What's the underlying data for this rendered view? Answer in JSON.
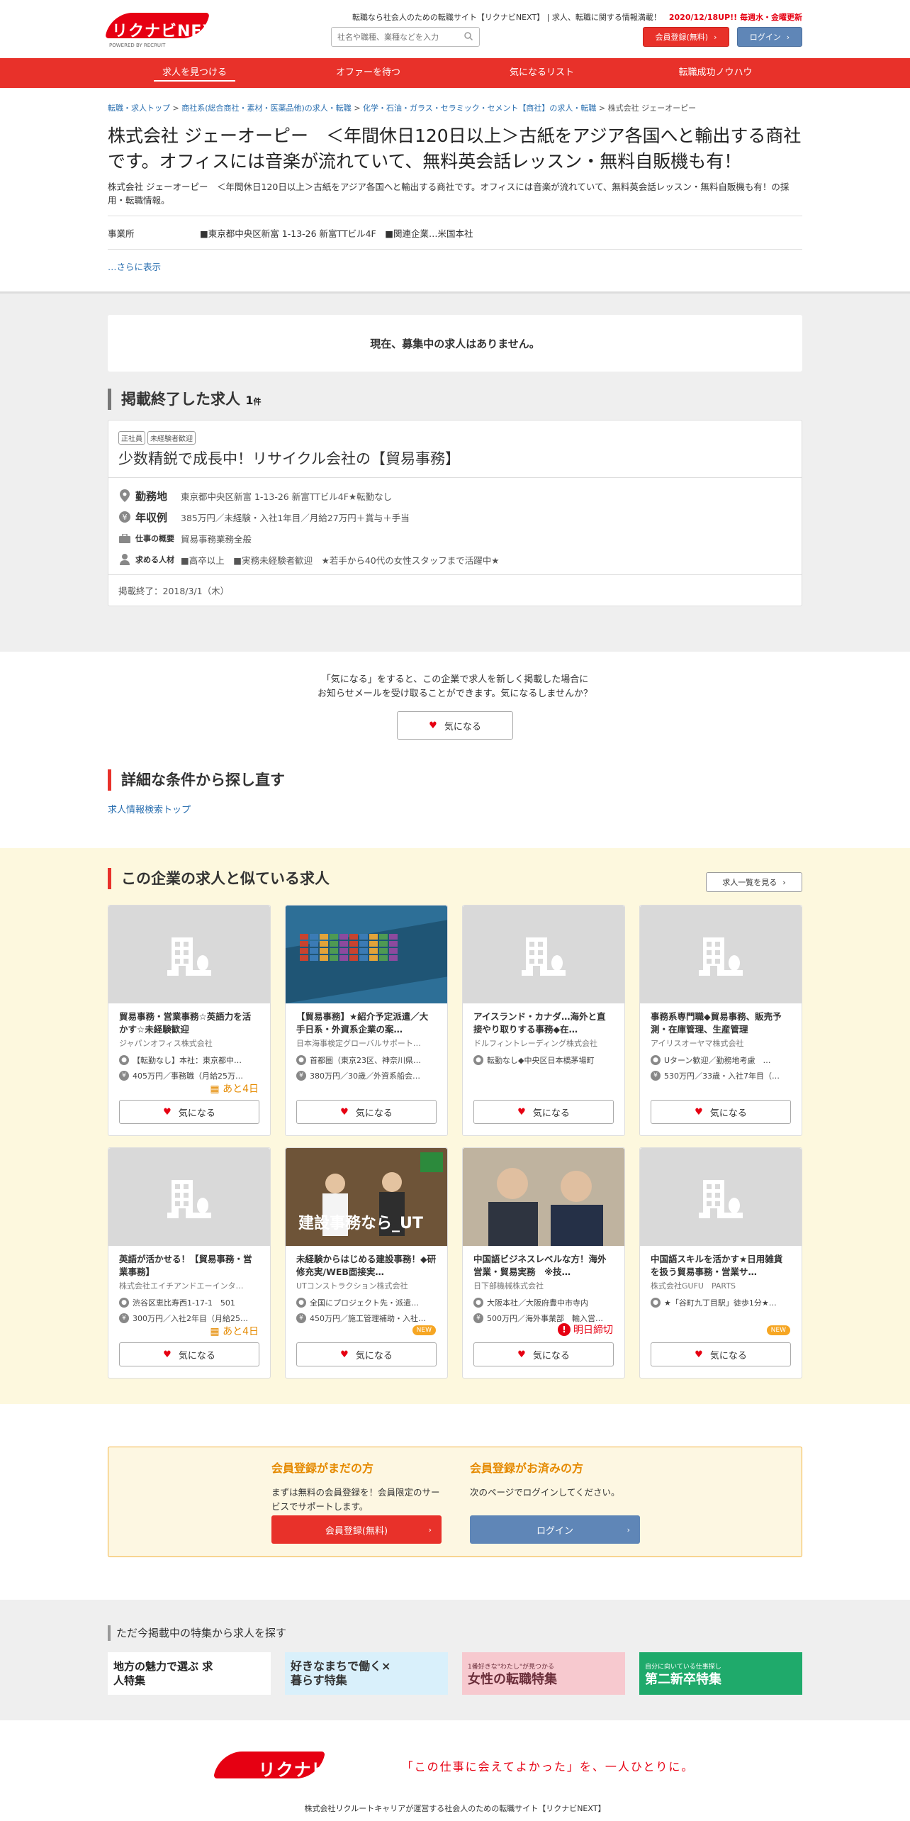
{
  "header": {
    "logo_text": "リクナビNEXT",
    "logo_sub": "POWERED BY RECRUIT",
    "tagline": "転職なら社会人のための転職サイト【リクナビNEXT】 | 求人、転職に関する情報満載！",
    "update": "2020/12/18UP!! 毎週水・金曜更新",
    "search_placeholder": "社名や職種、業種などを入力",
    "register_label": "会員登録(無料)",
    "login_label": "ログイン"
  },
  "nav": {
    "items": [
      {
        "label": "求人を見つける"
      },
      {
        "label": "オファーを待つ"
      },
      {
        "label": "気になるリスト"
      },
      {
        "label": "転職成功ノウハウ"
      }
    ]
  },
  "breadcrumb": {
    "items": [
      "転職・求人トップ",
      "商社系(総合商社・素材・医薬品他)の求人・転職",
      "化学・石油・ガラス・セラミック・セメント【商社】の求人・転職"
    ],
    "sep": ">",
    "current": "株式会社 ジェーオーピー"
  },
  "company": {
    "title": "株式会社 ジェーオーピー　＜年間休日120日以上＞古紙をアジア各国へと輸出する商社です。オフィスには音楽が流れていて、無料英会話レッスン・無料自販機も有！",
    "description": "株式会社 ジェーオーピー　＜年間休日120日以上＞古紙をアジア各国へと輸出する商社です。オフィスには音楽が流れていて、無料英会話レッスン・無料自販機も有！の採用・転職情報。",
    "office_label": "事業所",
    "office_value": "■東京都中央区新富 1-13-26 新富TTビル4F　■関連企業…米国本社",
    "more_label": "…さらに表示"
  },
  "status": {
    "no_jobs": "現在、募集中の求人はありません。"
  },
  "ended": {
    "heading": "掲載終了した求人",
    "count": "1",
    "count_unit": "件",
    "tags": [
      "正社員",
      "未経験者歓迎"
    ],
    "job_title": "少数精鋭で成長中！リサイクル会社の【貿易事務】",
    "rows": [
      {
        "label": "勤務地",
        "value": "東京都中央区新富 1-13-26 新富TTビル4F★転勤なし"
      },
      {
        "label": "年収例",
        "value": "385万円／未経験・入社1年目／月給27万円＋賞与＋手当"
      },
      {
        "label": "仕事の概要",
        "value": "貿易事務業務全般"
      },
      {
        "label": "求める人材",
        "value": "■高卒以上　■実務未経験者歓迎　★若手から40代の女性スタッフまで活躍中★"
      }
    ],
    "end_date": "掲載終了：2018/3/1（木）"
  },
  "favorite_prompt": {
    "line1": "「気になる」をすると、この企業で求人を新しく掲載した場合に",
    "line2": "お知らせメールを受け取ることができます。気になるしませんか？",
    "button": "気になる"
  },
  "detail_search": {
    "heading": "詳細な条件から探し直す",
    "link": "求人情報検索トップ"
  },
  "similar": {
    "heading": "この企業の求人と似ている求人",
    "list_button": "求人一覧を見る",
    "fav_label": "気になる",
    "cards": [
      {
        "title": "貿易事務・営業事務☆英語力を活かす☆未経験歓迎",
        "company": "ジャパンオフィス株式会社",
        "loc": "【転勤なし】本社：東京都中…",
        "sal": "405万円／事務職（月給25万…",
        "badge": "days",
        "badge_text": "あと4日",
        "img": "building"
      },
      {
        "title": "【貿易事務】★紹介予定派遣／大手日系・外資系企業の案…",
        "company": "日本海事検定グローバルサポート…",
        "loc": "首都圏（東京23区、神奈川県…",
        "sal": "380万円／30歳／外資系船会…",
        "badge": "",
        "badge_text": "",
        "img": "ship"
      },
      {
        "title": "アイスランド・カナダ…海外と直接やり取りする事務◆在…",
        "company": "ドルフィントレーディング株式会社",
        "loc": "転勤なし◆中央区日本橋茅場町",
        "sal": "",
        "badge": "",
        "badge_text": "",
        "img": "building"
      },
      {
        "title": "事務系専門職◆貿易事務、販売予測・在庫管理、生産管理",
        "company": "アイリスオーヤマ株式会社",
        "loc": "Uターン歓迎／勤務地考慮　…",
        "sal": "530万円／33歳・入社7年目（…",
        "badge": "",
        "badge_text": "",
        "img": "building"
      },
      {
        "title": "英語が活かせる！【貿易事務・営業事務】",
        "company": "株式会社エイチアンドエーインタ…",
        "loc": "渋谷区恵比寿西1-17-1　501",
        "sal": "300万円／入社2年目（月給25…",
        "badge": "days",
        "badge_text": "あと4日",
        "img": "building"
      },
      {
        "title": "未経験からはじめる建設事務！◆研修充実/WEB面接実…",
        "company": "UTコンストラクション株式会社",
        "loc": "全国にプロジェクト先・派遣…",
        "sal": "450万円／施工管理補助・入社…",
        "badge": "new",
        "badge_text": "NEW",
        "img": "ut",
        "img_text": "建設事務なら_UT"
      },
      {
        "title": "中国語ビジネスレベルな方！海外営業・貿易実務　※技…",
        "company": "日下部機械株式会社",
        "loc": "大阪本社／大阪府豊中市寺内",
        "sal": "500万円／海外事業部　輸入営…",
        "badge": "tomorrow",
        "badge_text": "明日締切",
        "img": "people"
      },
      {
        "title": "中国語スキルを活かす★日用雑貨を扱う貿易事務・営業サ…",
        "company": "株式会社GUFU　PARTS",
        "loc": "★「谷町九丁目駅」徒歩1分★…",
        "sal": "",
        "badge": "new",
        "badge_text": "NEW",
        "img": "building"
      }
    ]
  },
  "member": {
    "new_heading": "会員登録がまだの方",
    "new_text": "まずは無料の会員登録を！会員限定のサービスでサポートします。",
    "new_button": "会員登録(無料)",
    "existing_heading": "会員登録がお済みの方",
    "existing_text": "次のページでログインしてください。",
    "existing_button": "ログイン"
  },
  "features": {
    "heading": "ただ今掲載中の特集から求人を探す",
    "banners": [
      {
        "text": "地方の魅力で選ぶ 求人特集",
        "bg": "#ffffff",
        "color": "#222"
      },
      {
        "text": "好きなまちで働く×暮らす特集",
        "bg": "#d9f0fb",
        "color": "#333"
      },
      {
        "text": "女性の転職特集",
        "sub": "1番好きな\"わたし\"が見つかる",
        "bg": "#f7c9cf",
        "color": "#6b2e3a"
      },
      {
        "text": "第二新卒特集",
        "sub": "自分に向いている仕事探し",
        "bg": "#1faa6b",
        "color": "#ffffff"
      }
    ]
  },
  "footer": {
    "slogan": "「この仕事に会えてよかった」を、一人ひとりに。",
    "copy": "株式会社リクルートキャリアが運営する社会人のための転職サイト【リクナビNEXT】"
  },
  "colors": {
    "brand_red": "#e8312a",
    "link": "#2a6fb0",
    "login_blue": "#5f86b7",
    "orange": "#e58a00"
  }
}
